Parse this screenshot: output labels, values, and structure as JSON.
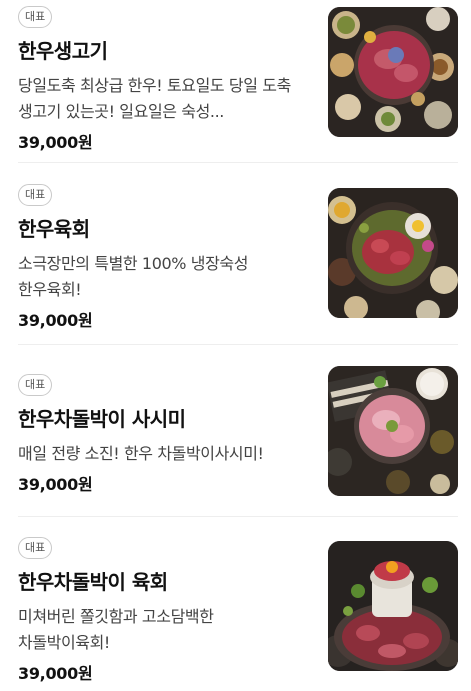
{
  "menu": {
    "items": [
      {
        "badge": "대표",
        "name": "한우생고기",
        "description": "당일도축 최상급 한우! 토요일도 당일 도축 생고기 있는곳! 일요일은 숙성...",
        "price": "39,000원",
        "image": "raw-beef-platter"
      },
      {
        "badge": "대표",
        "name": "한우육회",
        "description": "소극장만의 특별한 100% 냉장숙성 한우육회!",
        "price": "39,000원",
        "image": "beef-tartare-platter"
      },
      {
        "badge": "대표",
        "name": "한우차돌박이 사시미",
        "description": "매일 전량 소진! 한우 차돌박이사시미!",
        "price": "39,000원",
        "image": "brisket-sashimi-platter"
      },
      {
        "badge": "대표",
        "name": "한우차돌박이 육회",
        "description": "미쳐버린 쫄깃함과 고소담백한 차돌박이육회!",
        "price": "39,000원",
        "image": "brisket-yukhoe-tower"
      }
    ]
  }
}
